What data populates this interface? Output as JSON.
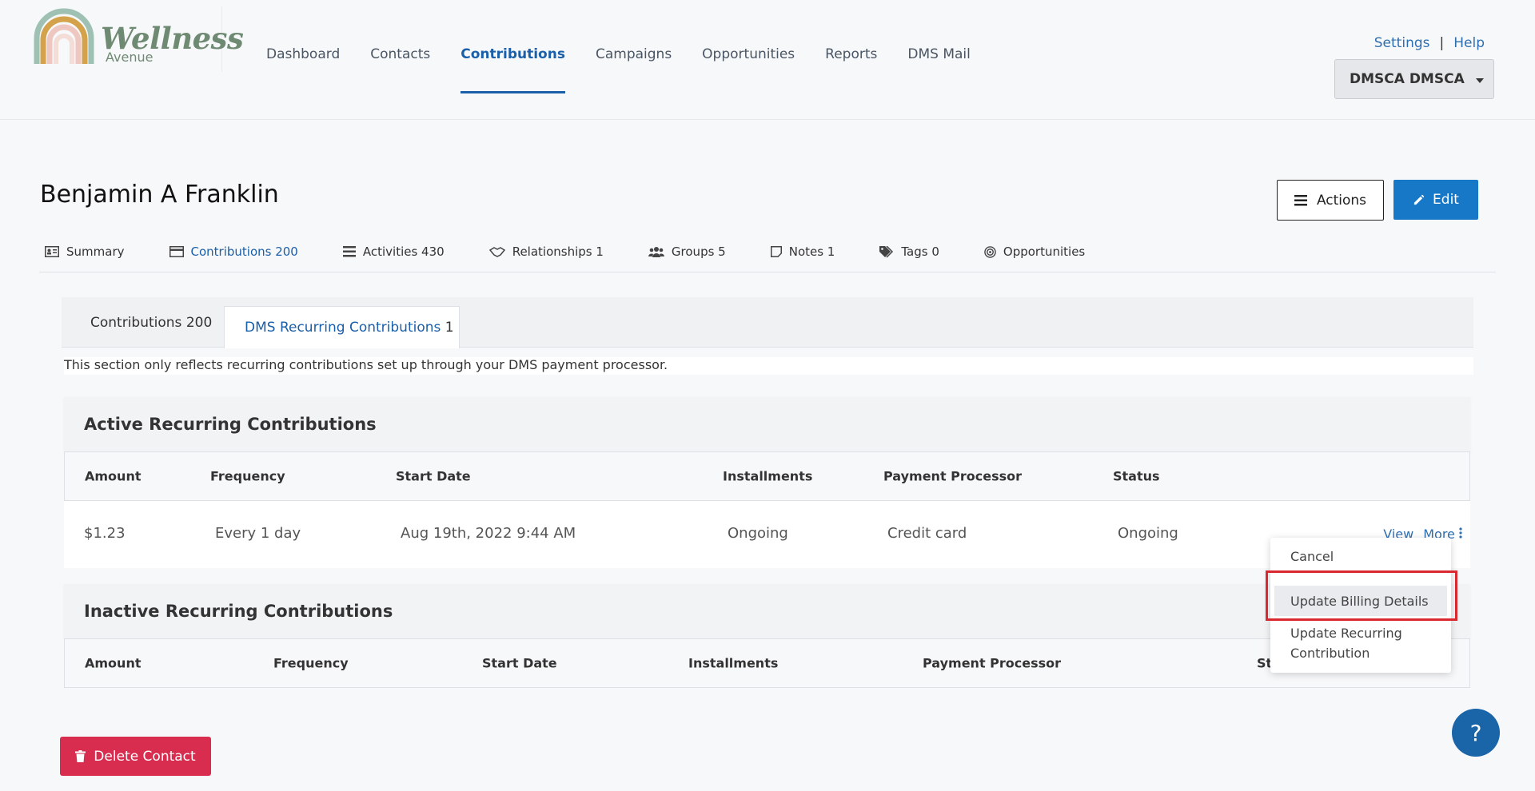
{
  "brand": {
    "name": "Wellness",
    "sub": "Avenue"
  },
  "nav": [
    {
      "label": "Dashboard"
    },
    {
      "label": "Contacts"
    },
    {
      "label": "Contributions",
      "active": true
    },
    {
      "label": "Campaigns"
    },
    {
      "label": "Opportunities"
    },
    {
      "label": "Reports"
    },
    {
      "label": "DMS Mail"
    }
  ],
  "toplinks": {
    "settings": "Settings",
    "sep": "|",
    "help": "Help"
  },
  "user": {
    "label": "DMSCA DMSCA"
  },
  "contact": {
    "name": "Benjamin A Franklin"
  },
  "buttons": {
    "actions": "Actions",
    "edit": "Edit",
    "delete": "Delete Contact",
    "help_fab": "?"
  },
  "contact_tabs": [
    {
      "label": "Summary",
      "icon": "id-card-icon"
    },
    {
      "label": "Contributions 200",
      "icon": "credit-card-icon",
      "active": true
    },
    {
      "label": "Activities 430",
      "icon": "list-icon"
    },
    {
      "label": "Relationships 1",
      "icon": "handshake-icon"
    },
    {
      "label": "Groups 5",
      "icon": "users-icon"
    },
    {
      "label": "Notes 1",
      "icon": "note-icon"
    },
    {
      "label": "Tags 0",
      "icon": "tags-icon"
    },
    {
      "label": "Opportunities",
      "icon": "target-icon"
    }
  ],
  "subtabs": {
    "t1": "Contributions 200",
    "t2_label": "DMS Recurring Contributions",
    "t2_count": "1"
  },
  "note": "This section only reflects recurring contributions set up through your DMS payment processor.",
  "active": {
    "title": "Active Recurring Contributions",
    "columns": [
      "Amount",
      "Frequency",
      "Start Date",
      "Installments",
      "Payment Processor",
      "Status"
    ],
    "rows": [
      {
        "amount": "$1.23",
        "frequency": "Every 1 day",
        "start_date": "Aug 19th, 2022 9:44 AM",
        "installments": "Ongoing",
        "processor": "Credit card",
        "status": "Ongoing",
        "view": "View",
        "more": "More"
      }
    ]
  },
  "inactive": {
    "title": "Inactive Recurring Contributions",
    "columns": [
      "Amount",
      "Frequency",
      "Start Date",
      "Installments",
      "Payment Processor",
      "Sta"
    ]
  },
  "dropdown": {
    "cancel": "Cancel",
    "billing": "Update Billing Details",
    "recurring": "Update Recurring Contribution"
  },
  "colors": {
    "primary": "#1778c8",
    "active_nav": "#1a5fa8",
    "danger": "#d92d50",
    "highlight": "#d9282f"
  }
}
